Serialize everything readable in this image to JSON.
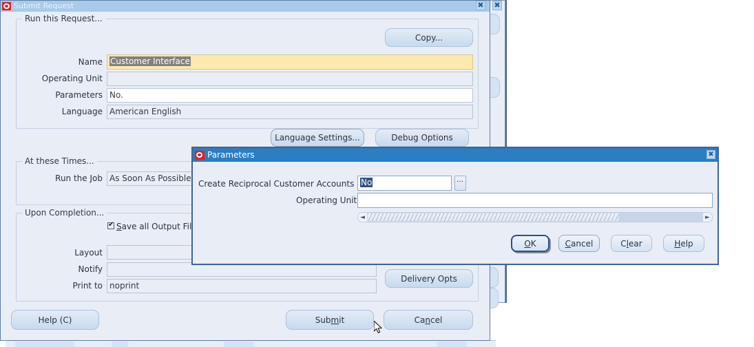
{
  "background_windows": {
    "close_button_label": "✖"
  },
  "submit_request": {
    "title": "Submit Request",
    "logo_icon": "oracle-logo-icon",
    "close_button_label": "✖",
    "groups": {
      "run_this_request": "Run this Request...",
      "at_these_times": "At these Times...",
      "upon_completion": "Upon Completion..."
    },
    "copy_button": "Copy...",
    "fields": {
      "name_label": "Name",
      "name_value": "Customer Interface",
      "operating_unit_label": "Operating Unit",
      "operating_unit_value": "",
      "parameters_label": "Parameters",
      "parameters_value": "No.",
      "language_label": "Language",
      "language_value": "American English",
      "run_the_job_label": "Run the Job",
      "run_the_job_value": "As Soon As Possible",
      "layout_label": "Layout",
      "layout_value": "",
      "notify_label": "Notify",
      "notify_value": "",
      "print_to_label": "Print to",
      "print_to_value": "noprint"
    },
    "buttons": {
      "language_settings": "Language Settings...",
      "debug_options": "Debug Options",
      "delivery_opts": "Delivery Opts",
      "help": "Help (C)",
      "help_mnemonic": "C",
      "submit": "Submit",
      "submit_pre": "Sub",
      "submit_mnemonic": "m",
      "submit_post": "it",
      "cancel": "Cancel",
      "cancel_pre": "Ca",
      "cancel_mnemonic": "n",
      "cancel_post": "cel"
    },
    "checkbox": {
      "label_pre": "",
      "label_mnemonic": "S",
      "label_post": "ave all Output File",
      "checked": true
    }
  },
  "parameters_dialog": {
    "title": "Parameters",
    "logo_icon": "oracle-logo-icon",
    "close_button_label": "✖",
    "fields": [
      {
        "label": "Create Reciprocal Customer Accounts",
        "value": "No",
        "selected": true,
        "has_lov": true,
        "lov_label": "…"
      },
      {
        "label": "Operating Unit",
        "value": "",
        "selected": false,
        "has_lov": false,
        "lov_label": ""
      }
    ],
    "scrollbar": {
      "left_arrow": "◄",
      "right_arrow": "►",
      "thumb_percent": 75
    },
    "buttons": {
      "ok": "OK",
      "ok_mnemonic": "O",
      "ok_post": "K",
      "cancel": "Cancel",
      "cancel_mnemonic": "C",
      "cancel_post": "ancel",
      "clear": "Clear",
      "clear_pre": "C",
      "clear_mnemonic": "l",
      "clear_post": "ear",
      "help": "Help",
      "help_mnemonic": "H",
      "help_post": "elp"
    }
  },
  "colors": {
    "active_title": "#2a7ec1",
    "inactive_title": "#a8cbe8",
    "window_bg": "#e9edf5",
    "field_yellow": "#fce9ae",
    "selection_blue": "#2e5582",
    "selection_grey": "#808080"
  }
}
